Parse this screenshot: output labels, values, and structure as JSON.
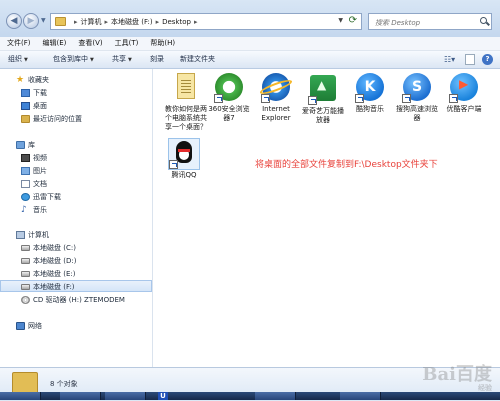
{
  "address": {
    "crumbs": [
      "计算机",
      "本地磁盘 (F:)",
      "Desktop"
    ],
    "search_placeholder": "搜索 Desktop"
  },
  "menu": [
    "文件(F)",
    "编辑(E)",
    "查看(V)",
    "工具(T)",
    "帮助(H)"
  ],
  "toolbar": {
    "organize": "组织",
    "include": "包含到库中",
    "share": "共享",
    "burn": "刻录",
    "new_folder": "新建文件夹"
  },
  "sidebar": {
    "favorites": "收藏夹",
    "fav_items": [
      "下载",
      "桌面",
      "最近访问的位置"
    ],
    "library": "库",
    "lib_items": [
      "视频",
      "图片",
      "文档",
      "迅雷下载",
      "音乐"
    ],
    "computer": "计算机",
    "drives": [
      "本地磁盘 (C:)",
      "本地磁盘 (D:)",
      "本地磁盘 (E:)",
      "本地磁盘 (F:)",
      "CD 驱动器 (H:) ZTEMODEM"
    ],
    "network": "网络"
  },
  "files": [
    {
      "label": "教你如何是两个电脑系统共享一个桌面？",
      "icon": "text-file-icon"
    },
    {
      "label": "360安全浏览器7",
      "icon": "360-browser-icon"
    },
    {
      "label": "Internet Explorer",
      "icon": "ie-icon"
    },
    {
      "label": "爱奇艺万能播放器",
      "icon": "iqiyi-player-icon"
    },
    {
      "label": "酷狗音乐",
      "icon": "kugou-icon"
    },
    {
      "label": "搜狗高速浏览器",
      "icon": "sogou-browser-icon"
    },
    {
      "label": "优酷客户端",
      "icon": "youku-icon"
    },
    {
      "label": "腾讯QQ",
      "icon": "qq-icon"
    }
  ],
  "annotation": "将桌面的全部文件复制到F:\\Desktop文件夹下",
  "details": {
    "count": "8 个对象"
  },
  "watermark": {
    "text": "Bai百度",
    "sub": "经验"
  },
  "taskbar": {
    "badge": "U"
  }
}
